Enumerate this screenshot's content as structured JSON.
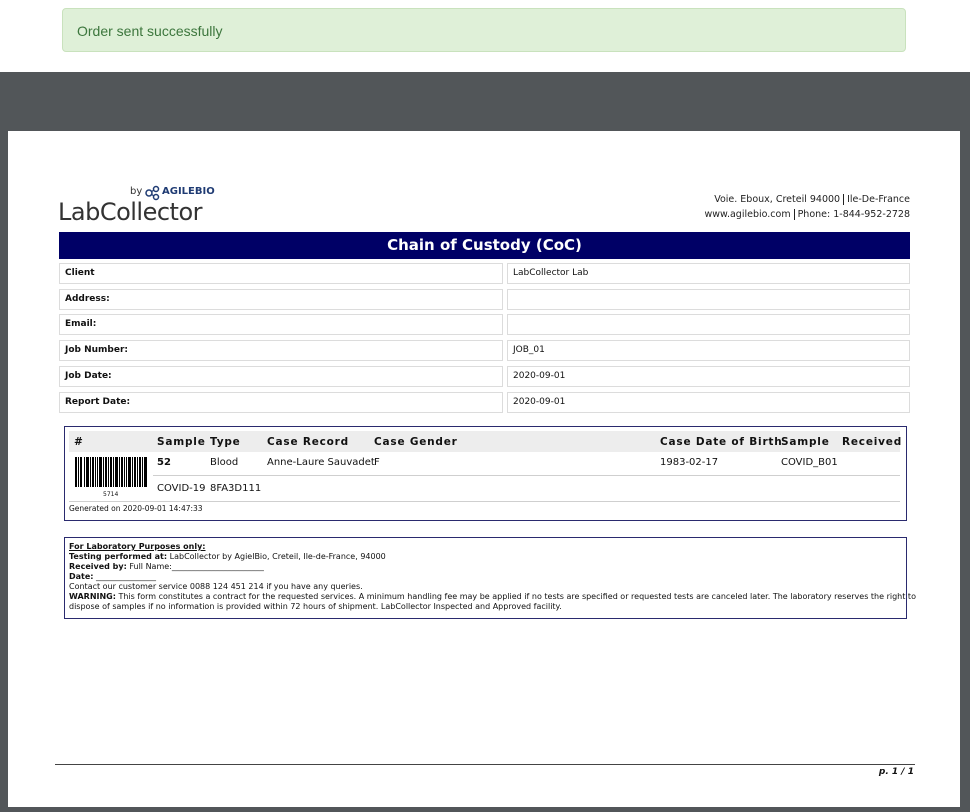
{
  "alert": {
    "message": "Order sent successfully"
  },
  "header": {
    "logo": {
      "by": "by",
      "agile": "AGILEBIO",
      "brand": "LabCollector"
    },
    "address": "Voie. Eboux, Creteil 94000",
    "region": "Ile-De-France",
    "website": "www.agilebio.com",
    "phone": "Phone: 1-844-952-2728"
  },
  "form": {
    "title": "Chain of Custody (CoC)",
    "fields": [
      {
        "label": "Client",
        "value": "LabCollector Lab"
      },
      {
        "label": "Address:",
        "value": ""
      },
      {
        "label": "Email:",
        "value": ""
      },
      {
        "label": "Job Number:",
        "value": "JOB_01"
      },
      {
        "label": "Job Date:",
        "value": "2020-09-01"
      },
      {
        "label": "Report Date:",
        "value": "2020-09-01"
      }
    ]
  },
  "samples": {
    "headers": [
      "#",
      "Sample",
      "Type",
      "Case Record",
      "Case Gender",
      "Case Date of Birth",
      "Sample",
      "Received"
    ],
    "row": {
      "id": "52",
      "type": "Blood",
      "case_record": "Anne-Laure Sauvadet",
      "case_gender": "F",
      "case_dob": "1983-02-17",
      "sample": "COVID_B01",
      "test": "COVID-19",
      "code": "8FA3D111",
      "barcode_number": "5714"
    },
    "generated": "Generated on 2020-09-01 14:47:33"
  },
  "lab": {
    "heading": "For Laboratory Purposes only:",
    "testing_label": "Testing performed at:",
    "testing_value": "LabCollector by AgielBio, Creteil, Ile-de-France, 94000",
    "received_label": "Received by:",
    "received_value": "Full Name:_______________________",
    "date_label": "Date:",
    "date_value": "_______________",
    "contact": "Contact our customer service 0088 124 451 214  if you have any queries.",
    "warning_label": "WARNING:",
    "warning_line1": "This form constitutes a contract for the requested services. A minimum handling fee may be applied if no tests are specified or requested tests are canceled later. The laboratory reserves the right to",
    "warning_line2": "dispose of samples if no information is provided within 72 hours of shipment. LabCollector Inspected and Approved facility."
  },
  "footer": {
    "page": "p. 1 / 1"
  },
  "colors": {
    "title_bar": "#000066",
    "alert_bg": "#dff0d8",
    "alert_text": "#3c763d",
    "logo_green": "#7ab929"
  }
}
